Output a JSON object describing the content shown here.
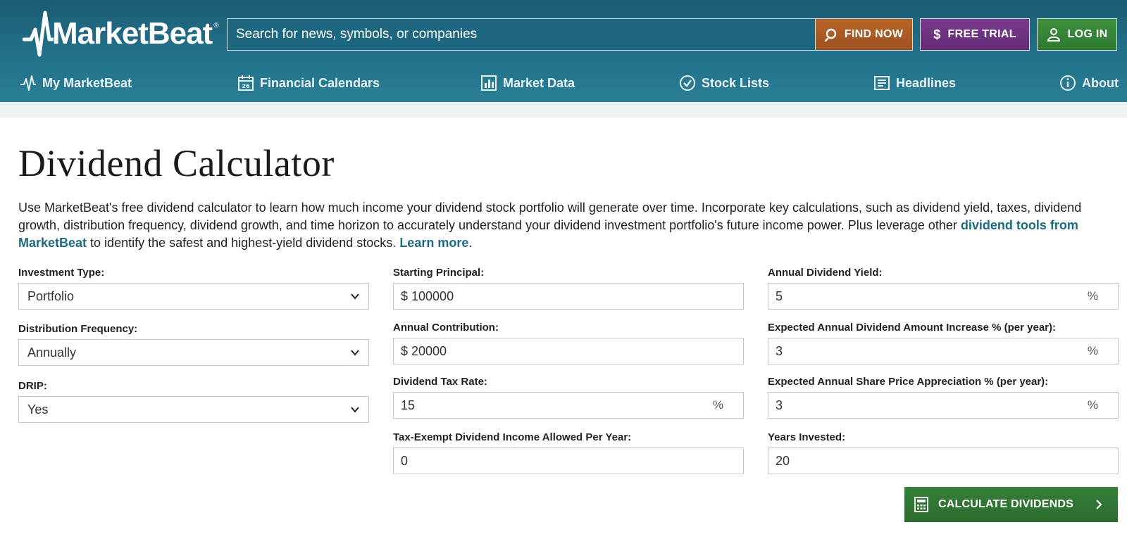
{
  "brand": {
    "logo_text": "MarketBeat",
    "registered": "®"
  },
  "search": {
    "placeholder": "Search for news, symbols, or companies",
    "button_label": "FIND NOW"
  },
  "header_buttons": {
    "trial_label": "FREE TRIAL",
    "login_label": "LOG IN"
  },
  "nav": {
    "items": [
      {
        "label": "My MarketBeat",
        "icon": "pulse-icon"
      },
      {
        "label": "Financial Calendars",
        "icon": "calendar-icon"
      },
      {
        "label": "Market Data",
        "icon": "bar-chart-icon"
      },
      {
        "label": "Stock Lists",
        "icon": "check-circle-icon"
      },
      {
        "label": "Headlines",
        "icon": "newspaper-icon"
      },
      {
        "label": "About",
        "icon": "info-icon"
      }
    ]
  },
  "page": {
    "title": "Dividend Calculator",
    "intro_part1": "Use MarketBeat's free dividend calculator to learn how much income your dividend stock portfolio will generate over time. Incorporate key calculations, such as dividend yield, taxes, dividend growth, distribution frequency, dividend growth, and time horizon to accurately understand your dividend investment portfolio's future income power. Plus leverage other ",
    "intro_link1": "dividend tools from MarketBeat",
    "intro_part2": " to identify the safest and highest-yield dividend stocks. ",
    "intro_link2": "Learn more",
    "intro_end": "."
  },
  "form": {
    "investment_type": {
      "label": "Investment Type:",
      "value": "Portfolio"
    },
    "distribution_frequency": {
      "label": "Distribution Frequency:",
      "value": "Annually"
    },
    "drip": {
      "label": "DRIP:",
      "value": "Yes"
    },
    "starting_principal": {
      "label": "Starting Principal:",
      "value": "$ 100000"
    },
    "annual_contribution": {
      "label": "Annual Contribution:",
      "value": "$ 20000"
    },
    "dividend_tax_rate": {
      "label": "Dividend Tax Rate:",
      "value": "15",
      "unit": "%"
    },
    "tax_exempt": {
      "label": "Tax-Exempt Dividend Income Allowed Per Year:",
      "value": "0"
    },
    "annual_dividend_yield": {
      "label": "Annual Dividend Yield:",
      "value": "5",
      "unit": "%"
    },
    "dividend_increase": {
      "label": "Expected Annual Dividend Amount Increase % (per year):",
      "value": "3",
      "unit": "%"
    },
    "price_appreciation": {
      "label": "Expected Annual Share Price Appreciation % (per year):",
      "value": "3",
      "unit": "%"
    },
    "years_invested": {
      "label": "Years Invested:",
      "value": "20"
    }
  },
  "calculate": {
    "label": "CALCULATE DIVIDENDS"
  },
  "colors": {
    "header": "#21718a",
    "find": "#a65a24",
    "trial": "#6e3281",
    "login": "#358538",
    "link": "#1d6a82"
  }
}
